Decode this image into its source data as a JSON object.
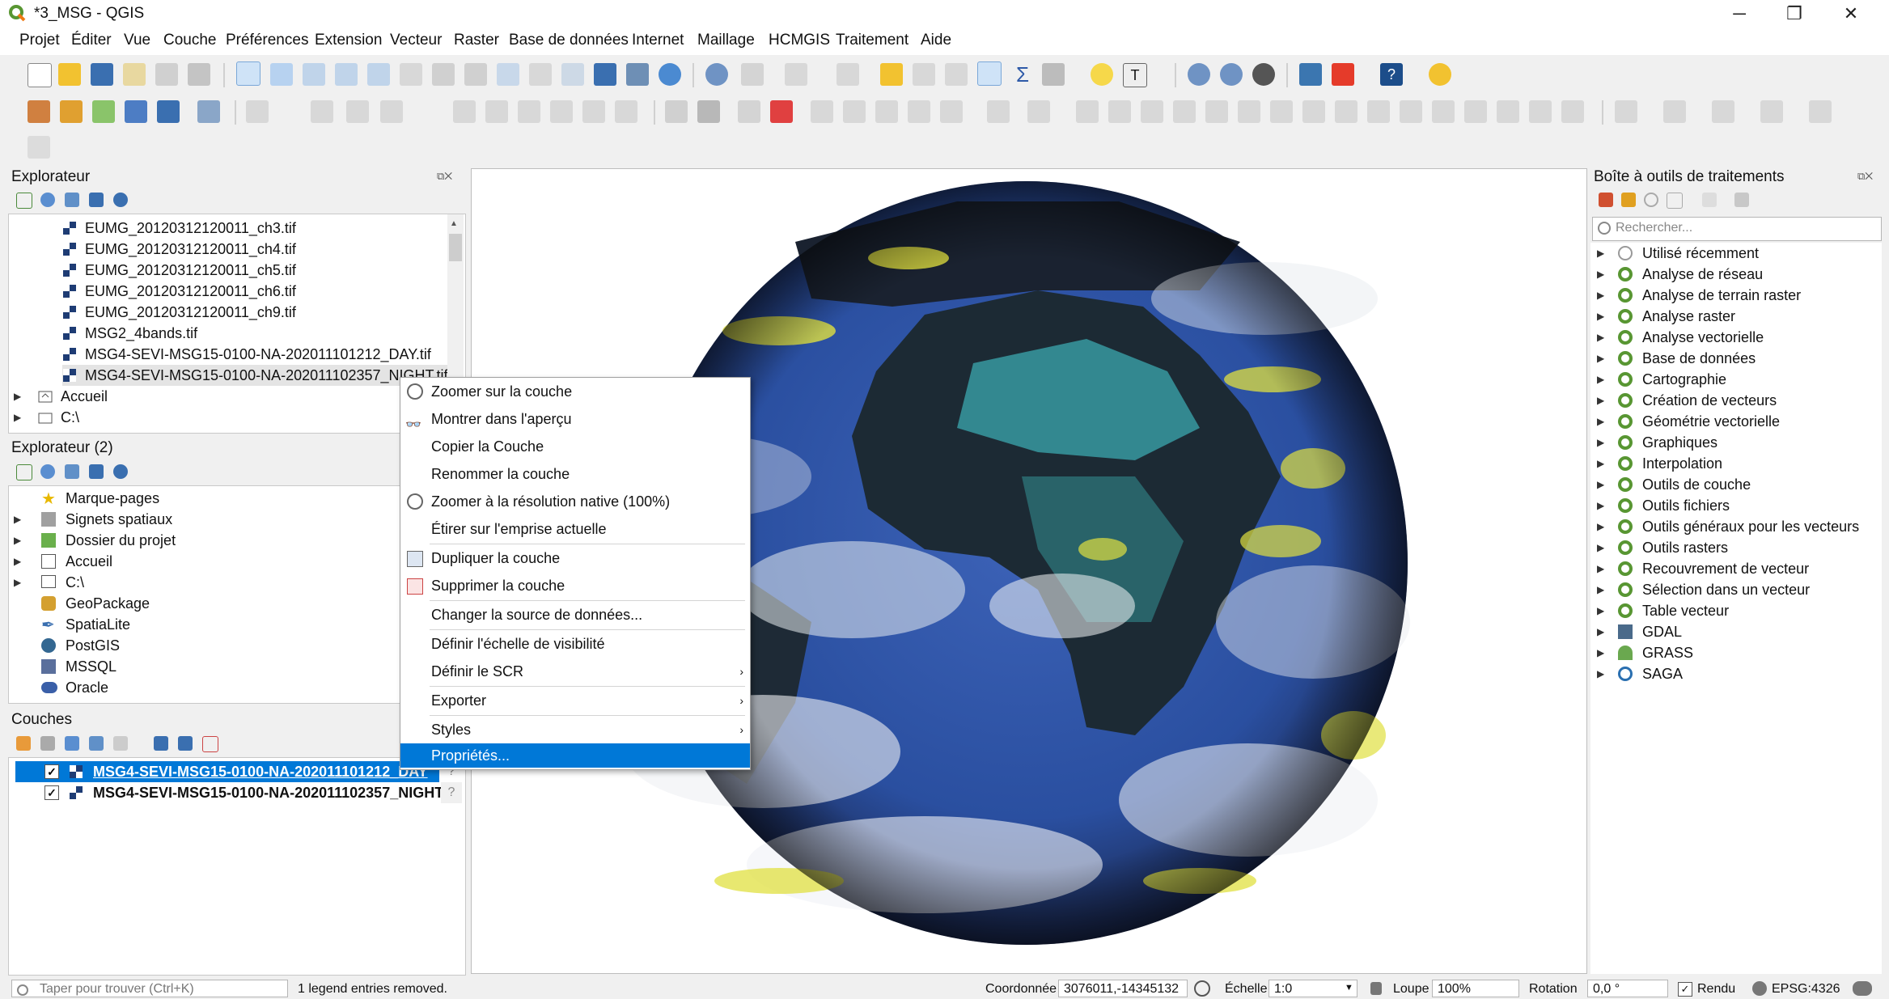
{
  "window": {
    "title": "*3_MSG - QGIS",
    "minimize": "─",
    "restore": "❐",
    "close": "✕"
  },
  "menu": [
    "Projet",
    "Éditer",
    "Vue",
    "Couche",
    "Préférences",
    "Extension",
    "Vecteur",
    "Raster",
    "Base de données",
    "Internet",
    "Maillage",
    "HCMGIS",
    "Traitement",
    "Aide"
  ],
  "browser": {
    "title": "Explorateur",
    "files": [
      "EUMG_20120312120011_ch3.tif",
      "EUMG_20120312120011_ch4.tif",
      "EUMG_20120312120011_ch5.tif",
      "EUMG_20120312120011_ch6.tif",
      "EUMG_20120312120011_ch9.tif",
      "MSG2_4bands.tif",
      "MSG4-SEVI-MSG15-0100-NA-202011101212_DAY.tif",
      "MSG4-SEVI-MSG15-0100-NA-202011102357_NIGHT.tif"
    ],
    "roots": [
      "Accueil",
      "C:\\"
    ]
  },
  "browser2": {
    "title": "Explorateur (2)",
    "items": [
      "Marque-pages",
      "Signets spatiaux",
      "Dossier du projet",
      "Accueil",
      "C:\\",
      "GeoPackage",
      "SpatiaLite",
      "PostGIS",
      "MSSQL",
      "Oracle"
    ]
  },
  "layers": {
    "title": "Couches",
    "items": [
      {
        "name": "MSG4-SEVI-MSG15-0100-NA-202011101212_DAY",
        "checked": "✓",
        "selected": true
      },
      {
        "name": "MSG4-SEVI-MSG15-0100-NA-202011102357_NIGHT",
        "checked": "✓",
        "selected": false
      }
    ]
  },
  "context_menu": [
    {
      "label": "Zoomer sur la couche"
    },
    {
      "label": "Montrer dans l'aperçu"
    },
    {
      "label": "Copier la Couche"
    },
    {
      "label": "Renommer la couche"
    },
    {
      "label": "Zoomer à la résolution native (100%)"
    },
    {
      "label": "Étirer sur l'emprise actuelle"
    },
    {
      "label": "Dupliquer la couche"
    },
    {
      "label": "Supprimer la couche"
    },
    {
      "label": "Changer la source de données..."
    },
    {
      "label": "Définir l'échelle de visibilité"
    },
    {
      "label": "Définir le SCR",
      "submenu": "›"
    },
    {
      "label": "Exporter",
      "submenu": "›"
    },
    {
      "label": "Styles",
      "submenu": "›"
    },
    {
      "label": "Propriétés...",
      "selected": true
    }
  ],
  "toolbox": {
    "title": "Boîte à outils de traitements",
    "search_placeholder": "Rechercher...",
    "items": [
      "Utilisé récemment",
      "Analyse de réseau",
      "Analyse de terrain raster",
      "Analyse raster",
      "Analyse vectorielle",
      "Base de données",
      "Cartographie",
      "Création de vecteurs",
      "Géométrie vectorielle",
      "Graphiques",
      "Interpolation",
      "Outils de couche",
      "Outils fichiers",
      "Outils généraux pour les vecteurs",
      "Outils rasters",
      "Recouvrement de vecteur",
      "Sélection dans un vecteur",
      "Table vecteur",
      "GDAL",
      "GRASS",
      "SAGA"
    ]
  },
  "status": {
    "locator_placeholder": "Taper pour trouver (Ctrl+K)",
    "message": "1 legend entries removed.",
    "coord_label": "Coordonnée",
    "coord_value": "3076011,-14345132",
    "scale_label": "Échelle",
    "scale_value": "1:0",
    "magnifier_label": "Loupe",
    "magnifier_value": "100%",
    "rotation_label": "Rotation",
    "rotation_value": "0,0 °",
    "render_label": "Rendu",
    "crs": "EPSG:4326"
  },
  "colors": {
    "accent": "#0078d7",
    "qgis_green": "#589632",
    "earth_ocean": "#2a4fa0",
    "cloud_yellow": "#e0e040"
  }
}
